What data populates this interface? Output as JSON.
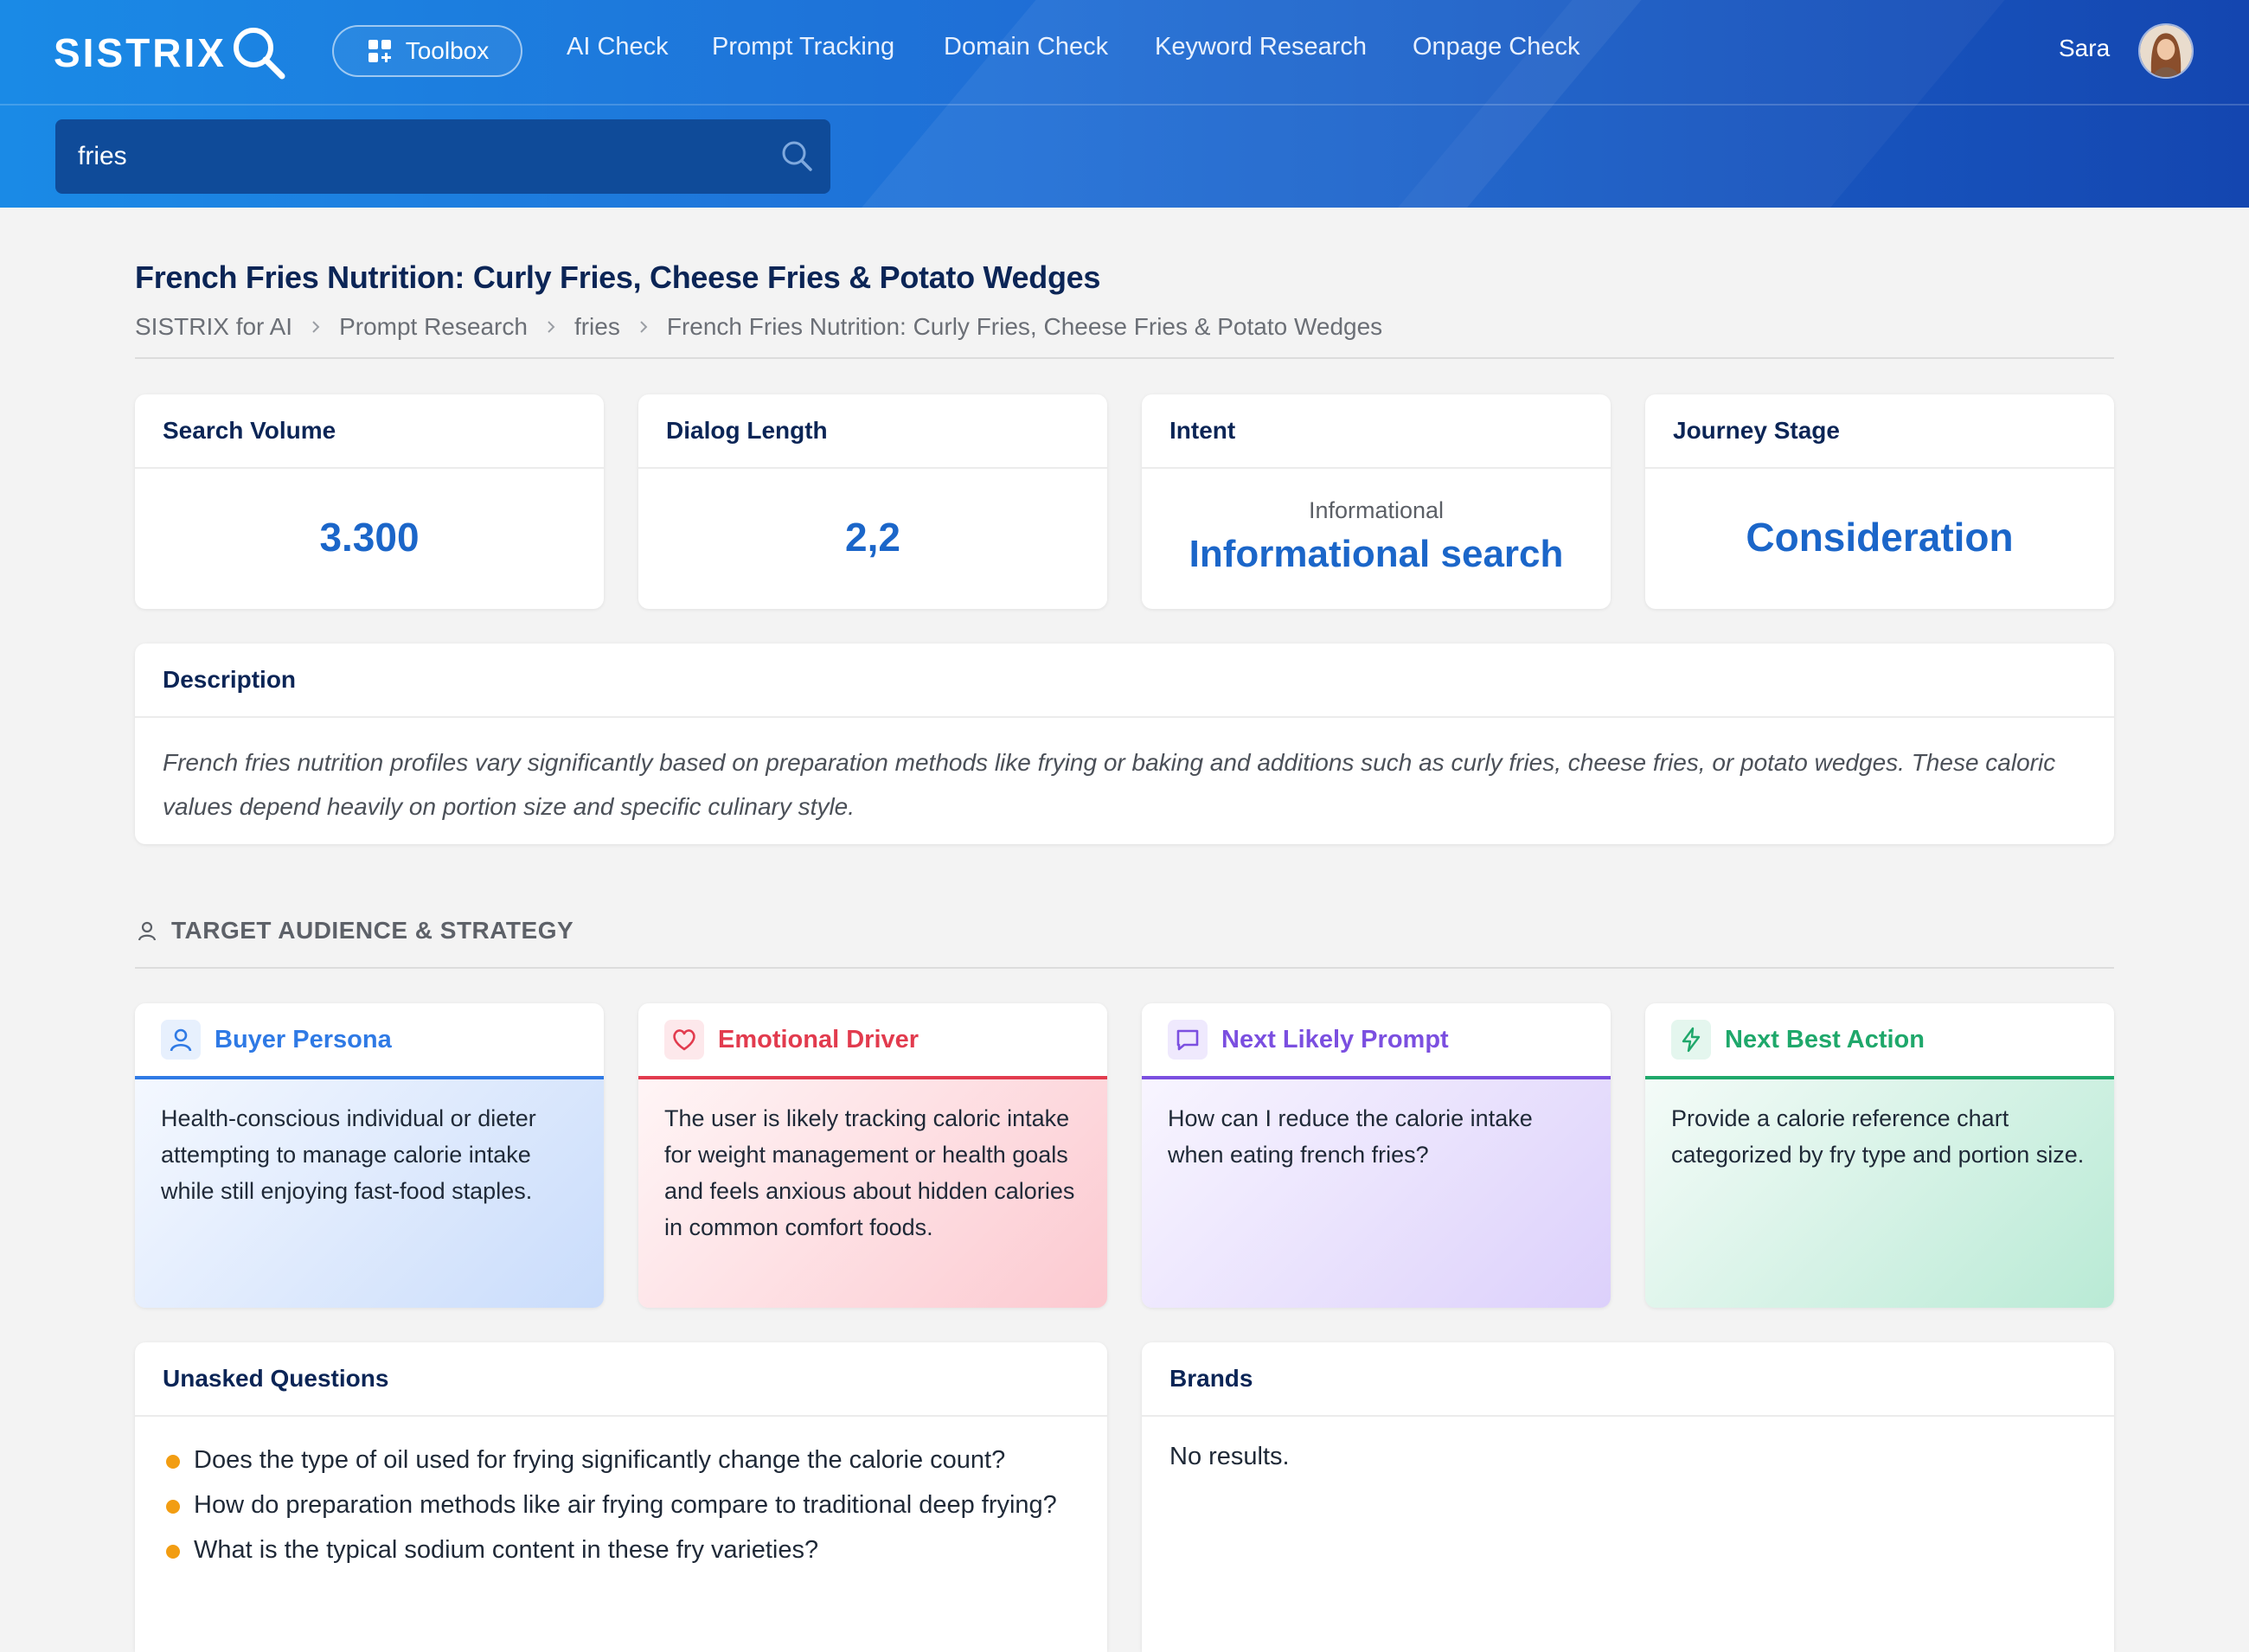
{
  "header": {
    "logo_text": "SISTRIX",
    "toolbox_label": "Toolbox",
    "nav": [
      "AI Check",
      "Prompt Tracking",
      "Domain Check",
      "Keyword Research",
      "Onpage Check"
    ],
    "user_name": "Sara",
    "search_value": "fries"
  },
  "page": {
    "title": "French Fries Nutrition: Curly Fries, Cheese Fries & Potato Wedges",
    "breadcrumbs": [
      "SISTRIX for AI",
      "Prompt Research",
      "fries",
      "French Fries Nutrition: Curly Fries, Cheese Fries & Potato Wedges"
    ]
  },
  "metrics": {
    "search_volume": {
      "label": "Search Volume",
      "value": "3.300"
    },
    "dialog_length": {
      "label": "Dialog Length",
      "value": "2,2"
    },
    "intent": {
      "label": "Intent",
      "sub": "Informational",
      "value": "Informational search"
    },
    "journey_stage": {
      "label": "Journey Stage",
      "value": "Consideration"
    }
  },
  "description": {
    "label": "Description",
    "text": "French fries nutrition profiles vary significantly based on preparation methods like frying or baking and additions such as curly fries, cheese fries, or potato wedges. These caloric values depend heavily on portion size and specific culinary style."
  },
  "strategy": {
    "section_label": "TARGET AUDIENCE & STRATEGY",
    "cards": [
      {
        "title": "Buyer Persona",
        "icon": "user-icon",
        "color": "#2f7ae5",
        "text": "Health-conscious individual or dieter attempting to manage calorie intake while still enjoying fast-food staples."
      },
      {
        "title": "Emotional Driver",
        "icon": "heart-icon",
        "color": "#e23b4e",
        "text": "The user is likely tracking caloric intake for weight management or health goals and feels anxious about hidden calories in common comfort foods."
      },
      {
        "title": "Next Likely Prompt",
        "icon": "chat-icon",
        "color": "#7b4fe0",
        "text": "How can I reduce the calorie intake when eating french fries?"
      },
      {
        "title": "Next Best Action",
        "icon": "lightning-icon",
        "color": "#1fa86b",
        "text": "Provide a calorie reference chart categorized by fry type and portion size."
      }
    ]
  },
  "unasked_questions": {
    "label": "Unasked Questions",
    "items": [
      "Does the type of oil used for frying significantly change the calorie count?",
      "How do preparation methods like air frying compare to traditional deep frying?",
      "What is the typical sodium content in these fry varieties?"
    ]
  },
  "brands": {
    "label": "Brands",
    "empty_text": "No results."
  }
}
